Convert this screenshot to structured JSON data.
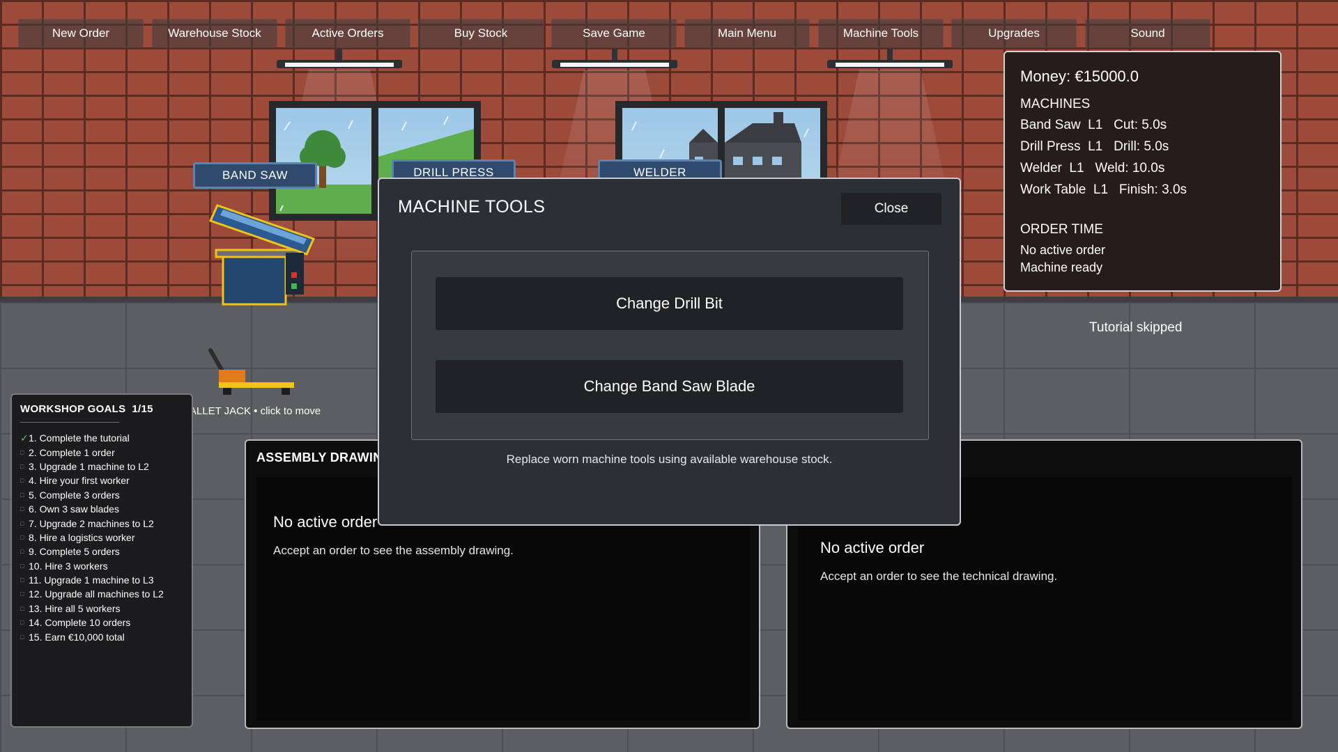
{
  "toolbar": {
    "new_order": "New Order",
    "warehouse_stock": "Warehouse Stock",
    "active_orders": "Active Orders",
    "buy_stock": "Buy Stock",
    "save_game": "Save Game",
    "main_menu": "Main Menu",
    "machine_tools": "Machine Tools",
    "upgrades": "Upgrades",
    "sound": "Sound"
  },
  "stats": {
    "money": "Money: €15000.0",
    "machines_heading": "MACHINES",
    "machines": [
      "Band Saw  L1   Cut: 5.0s",
      "Drill Press  L1   Drill: 5.0s",
      "Welder  L1   Weld: 10.0s",
      "Work Table  L1   Finish: 3.0s"
    ],
    "order_time_heading": "ORDER TIME",
    "order_status": "No active order",
    "machine_status": "Machine ready"
  },
  "tutorial_status": "Tutorial skipped",
  "signs": {
    "band_saw": "BAND SAW",
    "drill_press": "DRILL PRESS",
    "welder": "WELDER"
  },
  "pallet_label": "PALLET JACK • click to move",
  "goals": {
    "title": "WORKSHOP GOALS  1/15",
    "items": [
      {
        "label": "1. Complete the tutorial",
        "done": true
      },
      {
        "label": "2. Complete 1 order",
        "done": false
      },
      {
        "label": "3. Upgrade 1 machine to L2",
        "done": false
      },
      {
        "label": "4. Hire your first worker",
        "done": false
      },
      {
        "label": "5. Complete 3 orders",
        "done": false
      },
      {
        "label": "6. Own 3 saw blades",
        "done": false
      },
      {
        "label": "7. Upgrade 2 machines to L2",
        "done": false
      },
      {
        "label": "8. Hire a logistics worker",
        "done": false
      },
      {
        "label": "9. Complete 5 orders",
        "done": false
      },
      {
        "label": "10. Hire 3 workers",
        "done": false
      },
      {
        "label": "11. Upgrade 1 machine to L3",
        "done": false
      },
      {
        "label": "12. Upgrade all machines to L2",
        "done": false
      },
      {
        "label": "13. Hire all 5 workers",
        "done": false
      },
      {
        "label": "14. Complete 10 orders",
        "done": false
      },
      {
        "label": "15. Earn €10,000 total",
        "done": false
      }
    ]
  },
  "assembly_panel": {
    "title": "ASSEMBLY DRAWIN",
    "empty_title": "No active order",
    "empty_text": "Accept an order to see the assembly drawing."
  },
  "technical_panel": {
    "empty_title": "No active order",
    "empty_text": "Accept an order to see the technical drawing."
  },
  "modal": {
    "title": "MACHINE TOOLS",
    "close": "Close",
    "change_drill_bit": "Change Drill Bit",
    "change_band_saw_blade": "Change Band Saw Blade",
    "hint": "Replace worn machine tools using available warehouse stock."
  },
  "icons": {
    "goal_done": "check-icon",
    "goal_pending": "square-icon"
  },
  "colors": {
    "panel_bg": "#2b2f36",
    "goal_done": "#55c46a",
    "machine_highlight": "#f2c318"
  }
}
